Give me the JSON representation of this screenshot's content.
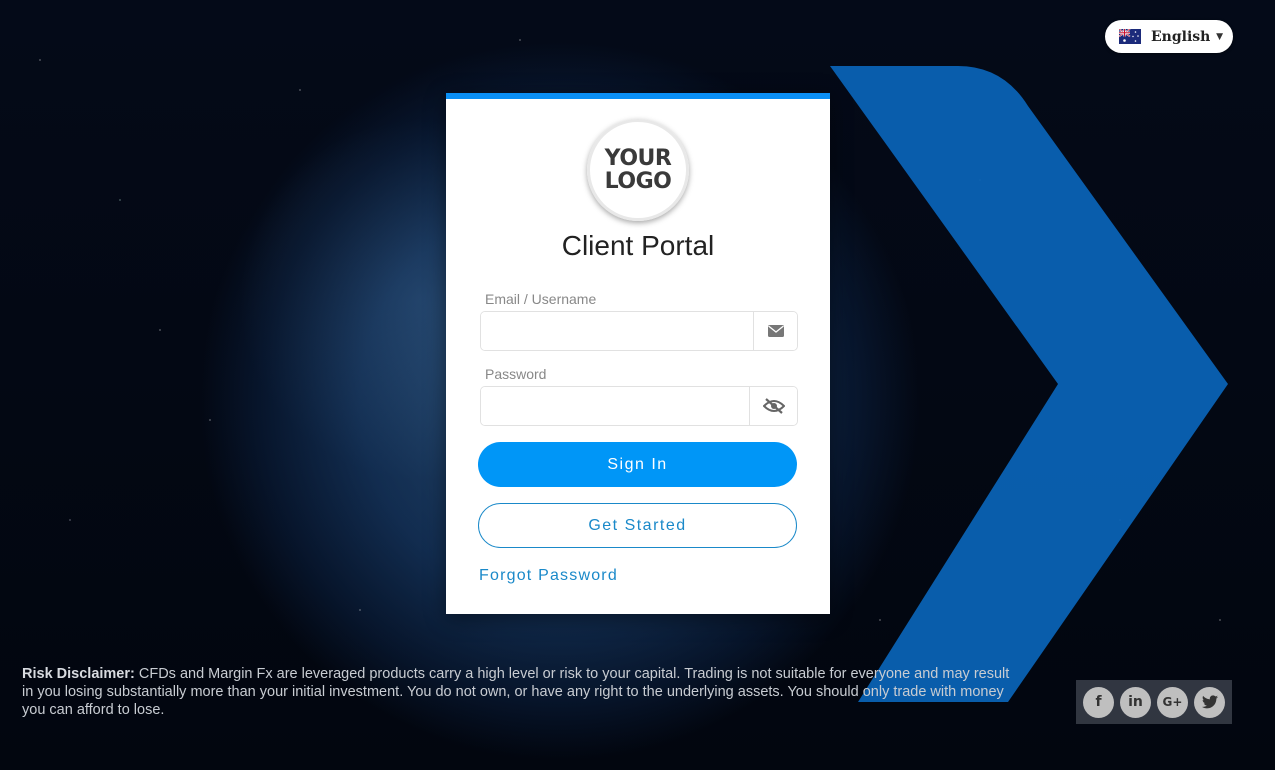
{
  "language": {
    "selected": "English",
    "flag_icon": "australia-flag-icon"
  },
  "card": {
    "accent_color": "#0a8ff5",
    "logo_line1": "YOUR",
    "logo_line2": "LOGO",
    "title": "Client Portal",
    "email": {
      "label": "Email / Username",
      "value": "",
      "icon": "envelope-icon"
    },
    "password": {
      "label": "Password",
      "value": "",
      "icon": "eye-slash-icon"
    },
    "sign_in_label": "Sign In",
    "get_started_label": "Get Started",
    "forgot_label": "Forgot Password"
  },
  "disclaimer": {
    "heading": "Risk Disclaimer:",
    "text": " CFDs and Margin Fx are leveraged products carry a high level or risk to your capital. Trading is not suitable for everyone and may result in you losing substantially more than your initial investment. You do not own, or have any right to the underlying assets. You should only trade with money you can afford to lose."
  },
  "social": [
    {
      "name": "facebook-icon",
      "glyph": "f"
    },
    {
      "name": "linkedin-icon",
      "glyph": "in"
    },
    {
      "name": "google-plus-icon",
      "glyph": "G+"
    },
    {
      "name": "twitter-icon",
      "glyph": "🐦"
    }
  ]
}
